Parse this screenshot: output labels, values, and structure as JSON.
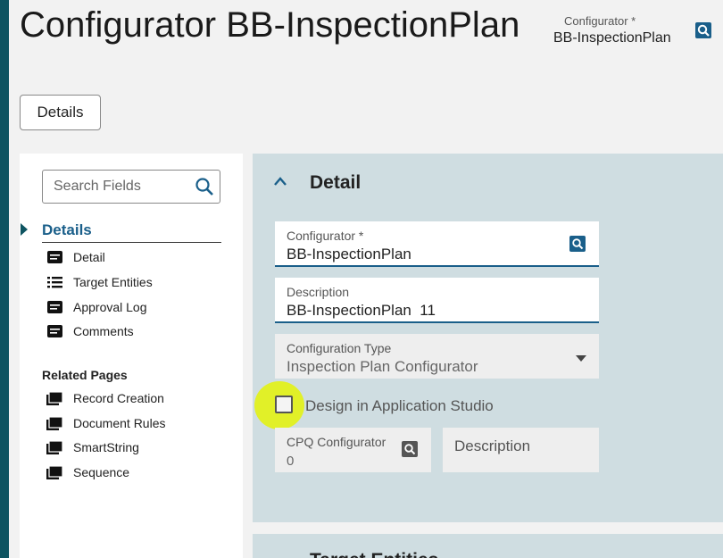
{
  "page": {
    "title": "Configurator BB-InspectionPlan",
    "header_field": {
      "label": "Configurator *",
      "value": "BB-InspectionPlan",
      "icon": "lookup-icon"
    }
  },
  "toolbar": {
    "details_button": "Details"
  },
  "sidebar": {
    "search_placeholder": "Search Fields",
    "section": "Details",
    "items": [
      {
        "label": "Detail",
        "icon": "detail-icon"
      },
      {
        "label": "Target Entities",
        "icon": "list-icon"
      },
      {
        "label": "Approval Log",
        "icon": "detail-icon"
      },
      {
        "label": "Comments",
        "icon": "detail-icon"
      }
    ],
    "related_title": "Related Pages",
    "related": [
      {
        "label": "Record Creation",
        "icon": "pages-icon"
      },
      {
        "label": "Document Rules",
        "icon": "pages-icon"
      },
      {
        "label": "SmartString",
        "icon": "pages-icon"
      },
      {
        "label": "Sequence",
        "icon": "pages-icon"
      }
    ]
  },
  "detail": {
    "title": "Detail",
    "configurator": {
      "label": "Configurator *",
      "value": "BB-InspectionPlan"
    },
    "description": {
      "label": "Description",
      "value": "BB-InspectionPlan  11"
    },
    "config_type": {
      "label": "Configuration Type",
      "value": "Inspection Plan Configurator"
    },
    "design_checkbox": {
      "label": "Design in Application Studio",
      "checked": false
    },
    "cpq": {
      "label": "CPQ Configurator",
      "value": "0"
    },
    "description2": {
      "label": "Description"
    }
  },
  "next_section": {
    "title": "Target Entities"
  },
  "colors": {
    "accent": "#1a5f8a",
    "strip": "#0e5461",
    "panel": "#cfdde1",
    "highlight": "#e1f01e"
  }
}
